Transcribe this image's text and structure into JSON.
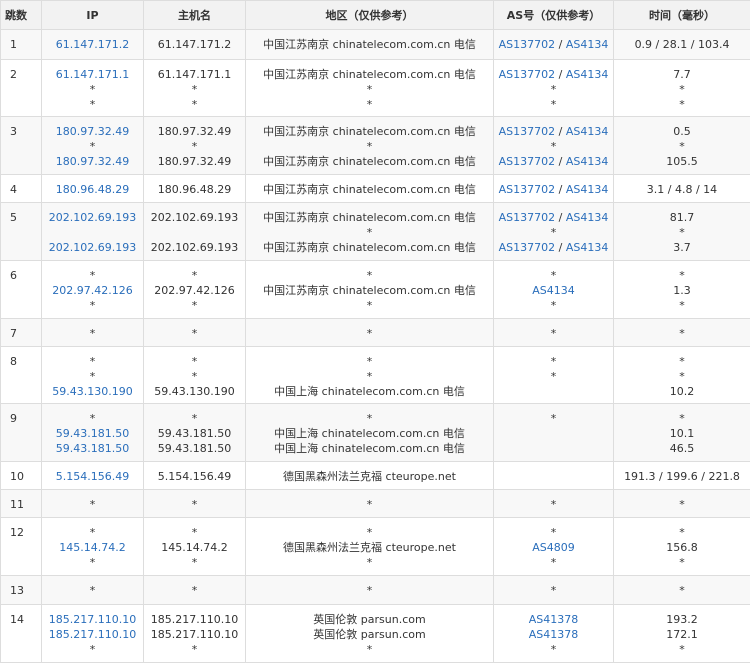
{
  "headers": [
    "跳数",
    "IP",
    "主机名",
    "地区（仅供参考）",
    "AS号（仅供参考）",
    "时间（毫秒）"
  ],
  "rows": [
    {
      "hop": "1",
      "height": 30,
      "lines": [
        {
          "ip": "61.147.171.2",
          "host": "61.147.171.2",
          "loc": "中国江苏南京 chinatelecom.com.cn 电信",
          "as": [
            "AS137702",
            "AS4134"
          ],
          "time": "0.9 / 28.1 / 103.4"
        }
      ]
    },
    {
      "hop": "2",
      "height": 56,
      "lines": [
        {
          "ip": "61.147.171.1",
          "host": "61.147.171.1",
          "loc": "中国江苏南京 chinatelecom.com.cn 电信",
          "as": [
            "AS137702",
            "AS4134"
          ],
          "time": "7.7"
        },
        {
          "ip": "*",
          "host": "*",
          "loc": "*",
          "as": [
            "*"
          ],
          "time": "*"
        },
        {
          "ip": "*",
          "host": "*",
          "loc": "*",
          "as": [
            "*"
          ],
          "time": "*"
        }
      ]
    },
    {
      "hop": "3",
      "height": 58,
      "lines": [
        {
          "ip": "180.97.32.49",
          "host": "180.97.32.49",
          "loc": "中国江苏南京 chinatelecom.com.cn 电信",
          "as": [
            "AS137702",
            "AS4134"
          ],
          "time": "0.5"
        },
        {
          "ip": "*",
          "host": "*",
          "loc": "*",
          "as": [
            "*"
          ],
          "time": "*"
        },
        {
          "ip": "180.97.32.49",
          "host": "180.97.32.49",
          "loc": "中国江苏南京 chinatelecom.com.cn 电信",
          "as": [
            "AS137702",
            "AS4134"
          ],
          "time": "105.5"
        }
      ]
    },
    {
      "hop": "4",
      "height": 28,
      "lines": [
        {
          "ip": "180.96.48.29",
          "host": "180.96.48.29",
          "loc": "中国江苏南京 chinatelecom.com.cn 电信",
          "as": [
            "AS137702",
            "AS4134"
          ],
          "time": "3.1 / 4.8 / 14"
        }
      ]
    },
    {
      "hop": "5",
      "height": 58,
      "lines": [
        {
          "ip": "202.102.69.193",
          "host": "202.102.69.193",
          "loc": "中国江苏南京 chinatelecom.com.cn 电信",
          "as": [
            "AS137702",
            "AS4134"
          ],
          "time": "81.7"
        },
        {
          "ip": "",
          "host": "",
          "loc": "*",
          "as": [
            "*"
          ],
          "time": "*"
        },
        {
          "ip": "202.102.69.193",
          "host": "202.102.69.193",
          "loc": "中国江苏南京 chinatelecom.com.cn 电信",
          "as": [
            "AS137702",
            "AS4134"
          ],
          "time": "3.7"
        }
      ]
    },
    {
      "hop": "6",
      "height": 58,
      "lines": [
        {
          "ip": "*",
          "host": "*",
          "loc": "*",
          "as": [
            "*"
          ],
          "time": "*"
        },
        {
          "ip": "202.97.42.126",
          "host": "202.97.42.126",
          "loc": "中国江苏南京 chinatelecom.com.cn 电信",
          "as": [
            "AS4134"
          ],
          "time": "1.3"
        },
        {
          "ip": "*",
          "host": "*",
          "loc": "*",
          "as": [
            "*"
          ],
          "time": "*"
        }
      ]
    },
    {
      "hop": "7",
      "height": 28,
      "lines": [
        {
          "ip": "*",
          "host": "*",
          "loc": "*",
          "as": [
            "*"
          ],
          "time": "*"
        }
      ]
    },
    {
      "hop": "8",
      "height": 57,
      "lines": [
        {
          "ip": "*",
          "host": "*",
          "loc": "*",
          "as": [
            "*"
          ],
          "time": "*"
        },
        {
          "ip": "*",
          "host": "*",
          "loc": "*",
          "as": [
            "*"
          ],
          "time": "*"
        },
        {
          "ip": "59.43.130.190",
          "host": "59.43.130.190",
          "loc": "中国上海 chinatelecom.com.cn 电信",
          "as": [],
          "time": "10.2"
        }
      ]
    },
    {
      "hop": "9",
      "height": 58,
      "lines": [
        {
          "ip": "*",
          "host": "*",
          "loc": "*",
          "as": [
            "*"
          ],
          "time": "*"
        },
        {
          "ip": "59.43.181.50",
          "host": "59.43.181.50",
          "loc": "中国上海 chinatelecom.com.cn 电信",
          "as": [],
          "time": "10.1"
        },
        {
          "ip": "59.43.181.50",
          "host": "59.43.181.50",
          "loc": "中国上海 chinatelecom.com.cn 电信",
          "as": [],
          "time": "46.5"
        }
      ]
    },
    {
      "hop": "10",
      "height": 28,
      "lines": [
        {
          "ip": "5.154.156.49",
          "host": "5.154.156.49",
          "loc": "德国黑森州法兰克福 cteurope.net",
          "as": [],
          "time": "191.3 / 199.6 / 221.8"
        }
      ]
    },
    {
      "hop": "11",
      "height": 28,
      "lines": [
        {
          "ip": "*",
          "host": "*",
          "loc": "*",
          "as": [
            "*"
          ],
          "time": "*"
        }
      ]
    },
    {
      "hop": "12",
      "height": 58,
      "lines": [
        {
          "ip": "*",
          "host": "*",
          "loc": "*",
          "as": [
            "*"
          ],
          "time": "*"
        },
        {
          "ip": "145.14.74.2",
          "host": "145.14.74.2",
          "loc": "德国黑森州法兰克福 cteurope.net",
          "as": [
            "AS4809"
          ],
          "time": "156.8"
        },
        {
          "ip": "*",
          "host": "*",
          "loc": "*",
          "as": [
            "*"
          ],
          "time": "*"
        }
      ]
    },
    {
      "hop": "13",
      "height": 29,
      "lines": [
        {
          "ip": "*",
          "host": "*",
          "loc": "*",
          "as": [
            "*"
          ],
          "time": "*"
        }
      ]
    },
    {
      "hop": "14",
      "height": 58,
      "lines": [
        {
          "ip": "185.217.110.10",
          "host": "185.217.110.10",
          "loc": "英国伦敦 parsun.com",
          "as": [
            "AS41378"
          ],
          "time": "193.2"
        },
        {
          "ip": "185.217.110.10",
          "host": "185.217.110.10",
          "loc": "英国伦敦 parsun.com",
          "as": [
            "AS41378"
          ],
          "time": "172.1"
        },
        {
          "ip": "*",
          "host": "*",
          "loc": "*",
          "as": [
            "*"
          ],
          "time": "*"
        }
      ]
    }
  ]
}
